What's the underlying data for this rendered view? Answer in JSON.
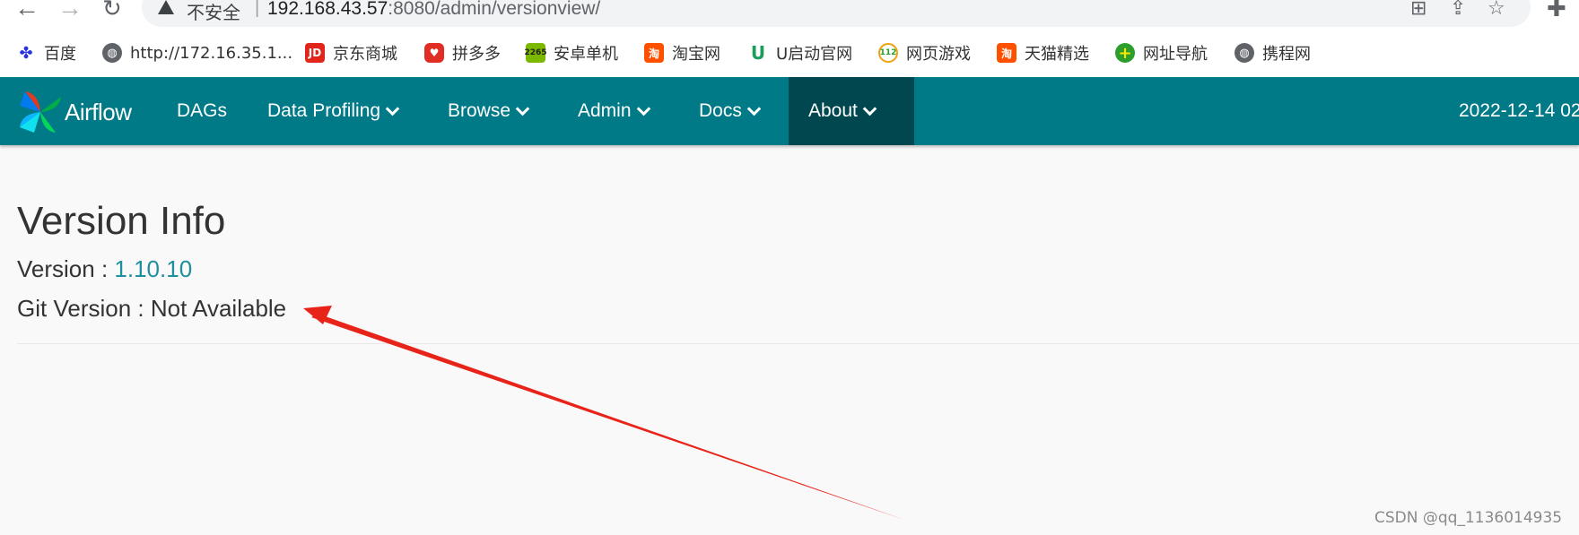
{
  "browser": {
    "security_label": "不安全",
    "separator": "|",
    "url_host": "192.168.43.57",
    "url_rest": ":8080/admin/versionview/",
    "bookmarks": [
      {
        "label": "百度",
        "icon": "baidu-icon",
        "color": "#2932e1"
      },
      {
        "label": "http://172.16.35.1...",
        "icon": "globe-icon",
        "color": "#5f6368"
      },
      {
        "label": "京东商城",
        "icon": "jd-icon",
        "color": "#e1251b"
      },
      {
        "label": "拼多多",
        "icon": "pinduoduo-icon",
        "color": "#e02e24"
      },
      {
        "label": "安卓单机",
        "icon": "2265-icon",
        "color": "#7cb800"
      },
      {
        "label": "淘宝网",
        "icon": "taobao-icon",
        "color": "#ff5000"
      },
      {
        "label": "U启动官网",
        "icon": "u-icon",
        "color": "#1a9e5c"
      },
      {
        "label": "网页游戏",
        "icon": "112-icon",
        "color": "#f0a30a"
      },
      {
        "label": "天猫精选",
        "icon": "tmall-icon",
        "color": "#ff5000"
      },
      {
        "label": "网址导航",
        "icon": "nav-plus-icon",
        "color": "#2b9e2b"
      },
      {
        "label": "携程网",
        "icon": "globe-icon",
        "color": "#5f6368"
      }
    ]
  },
  "navbar": {
    "brand": "Airflow",
    "items": [
      {
        "label": "DAGs",
        "dropdown": false
      },
      {
        "label": "Data Profiling",
        "dropdown": true
      },
      {
        "label": "Browse",
        "dropdown": true
      },
      {
        "label": "Admin",
        "dropdown": true
      },
      {
        "label": "Docs",
        "dropdown": true
      },
      {
        "label": "About",
        "dropdown": true,
        "active": true
      }
    ],
    "clock": "2022-12-14 02",
    "color": "#007a87",
    "active_color": "#00474f"
  },
  "main": {
    "title": "Version Info",
    "version_label": "Version : ",
    "version_value": "1.10.10",
    "git_label": "Git Version : ",
    "git_value": "Not Available"
  },
  "annotation": {
    "color": "#e8231a"
  },
  "watermark": "CSDN @qq_1136014935"
}
